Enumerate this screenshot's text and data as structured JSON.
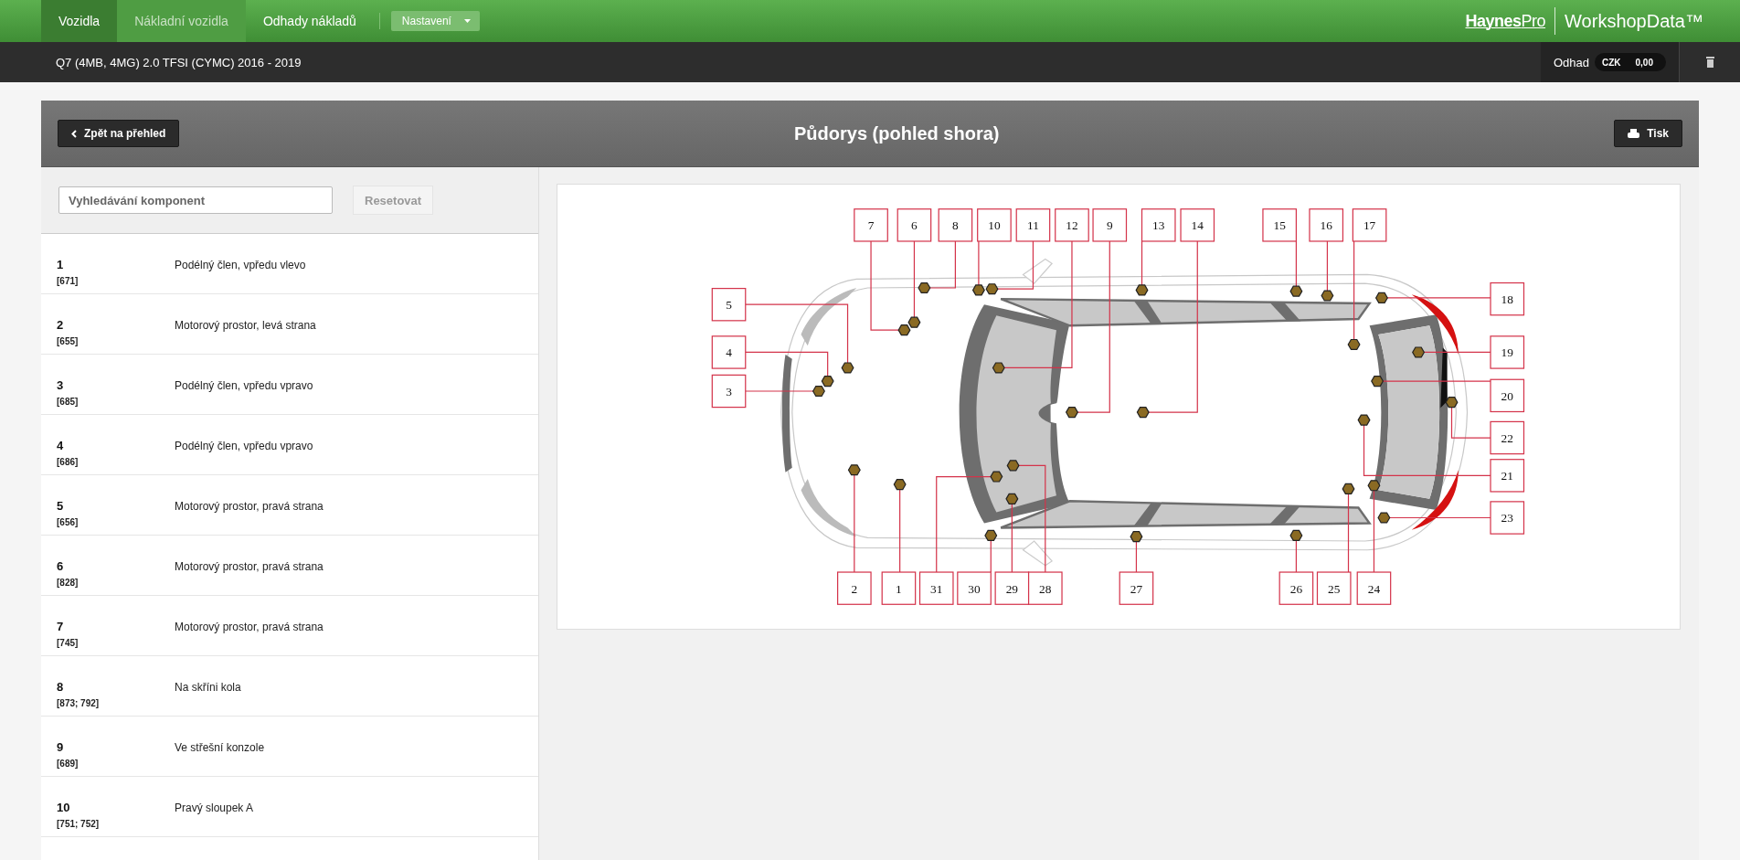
{
  "nav": {
    "tabs": [
      {
        "label": "Vozidla",
        "selected": true,
        "disabled": false
      },
      {
        "label": "Nákladní vozidla",
        "selected": false,
        "disabled": true
      },
      {
        "label": "Odhady nákladů",
        "selected": false,
        "disabled": false
      }
    ],
    "settings": "Nastavení",
    "logo": {
      "brand": "**Haynes**Pro",
      "product": "WorkshopData™"
    }
  },
  "vehicle_bar": {
    "vehicle": "Q7 (4MB, 4MG) 2.0 TFSI (CYMC) 2016 - 2019",
    "estimate_label": "Odhad",
    "currency": "CZK",
    "amount": "0,00"
  },
  "header": {
    "back": "Zpět na přehled",
    "title": "Půdorys (pohled shora)",
    "print": "Tisk"
  },
  "search": {
    "placeholder": "Vyhledávání komponent",
    "reset": {
      "label": "Resetovat",
      "disabled": true
    }
  },
  "components": [
    {
      "number": "1",
      "codes": "[671]",
      "location": "Podélný člen, vpředu vlevo"
    },
    {
      "number": "2",
      "codes": "[655]",
      "location": "Motorový prostor, levá strana"
    },
    {
      "number": "3",
      "codes": "[685]",
      "location": "Podélný člen, vpředu vpravo"
    },
    {
      "number": "4",
      "codes": "[686]",
      "location": "Podélný člen, vpředu vpravo"
    },
    {
      "number": "5",
      "codes": "[656]",
      "location": "Motorový prostor, pravá strana"
    },
    {
      "number": "6",
      "codes": "[828]",
      "location": "Motorový prostor, pravá strana"
    },
    {
      "number": "7",
      "codes": "[745]",
      "location": "Motorový prostor, pravá strana"
    },
    {
      "number": "8",
      "codes": "[873; 792]",
      "location": "Na skříni kola"
    },
    {
      "number": "9",
      "codes": "[689]",
      "location": "Ve střešní konzole"
    },
    {
      "number": "10",
      "codes": "[751; 752]",
      "location": "Pravý sloupek A"
    }
  ],
  "diagram": {
    "callouts": [
      "7",
      "6",
      "8",
      "10",
      "11",
      "12",
      "9",
      "13",
      "14",
      "15",
      "16",
      "17",
      "18",
      "5",
      "4",
      "19",
      "3",
      "20",
      "22",
      "21",
      "23",
      "2",
      "1",
      "31",
      "30",
      "29",
      "28",
      "27",
      "26",
      "25",
      "24"
    ]
  }
}
